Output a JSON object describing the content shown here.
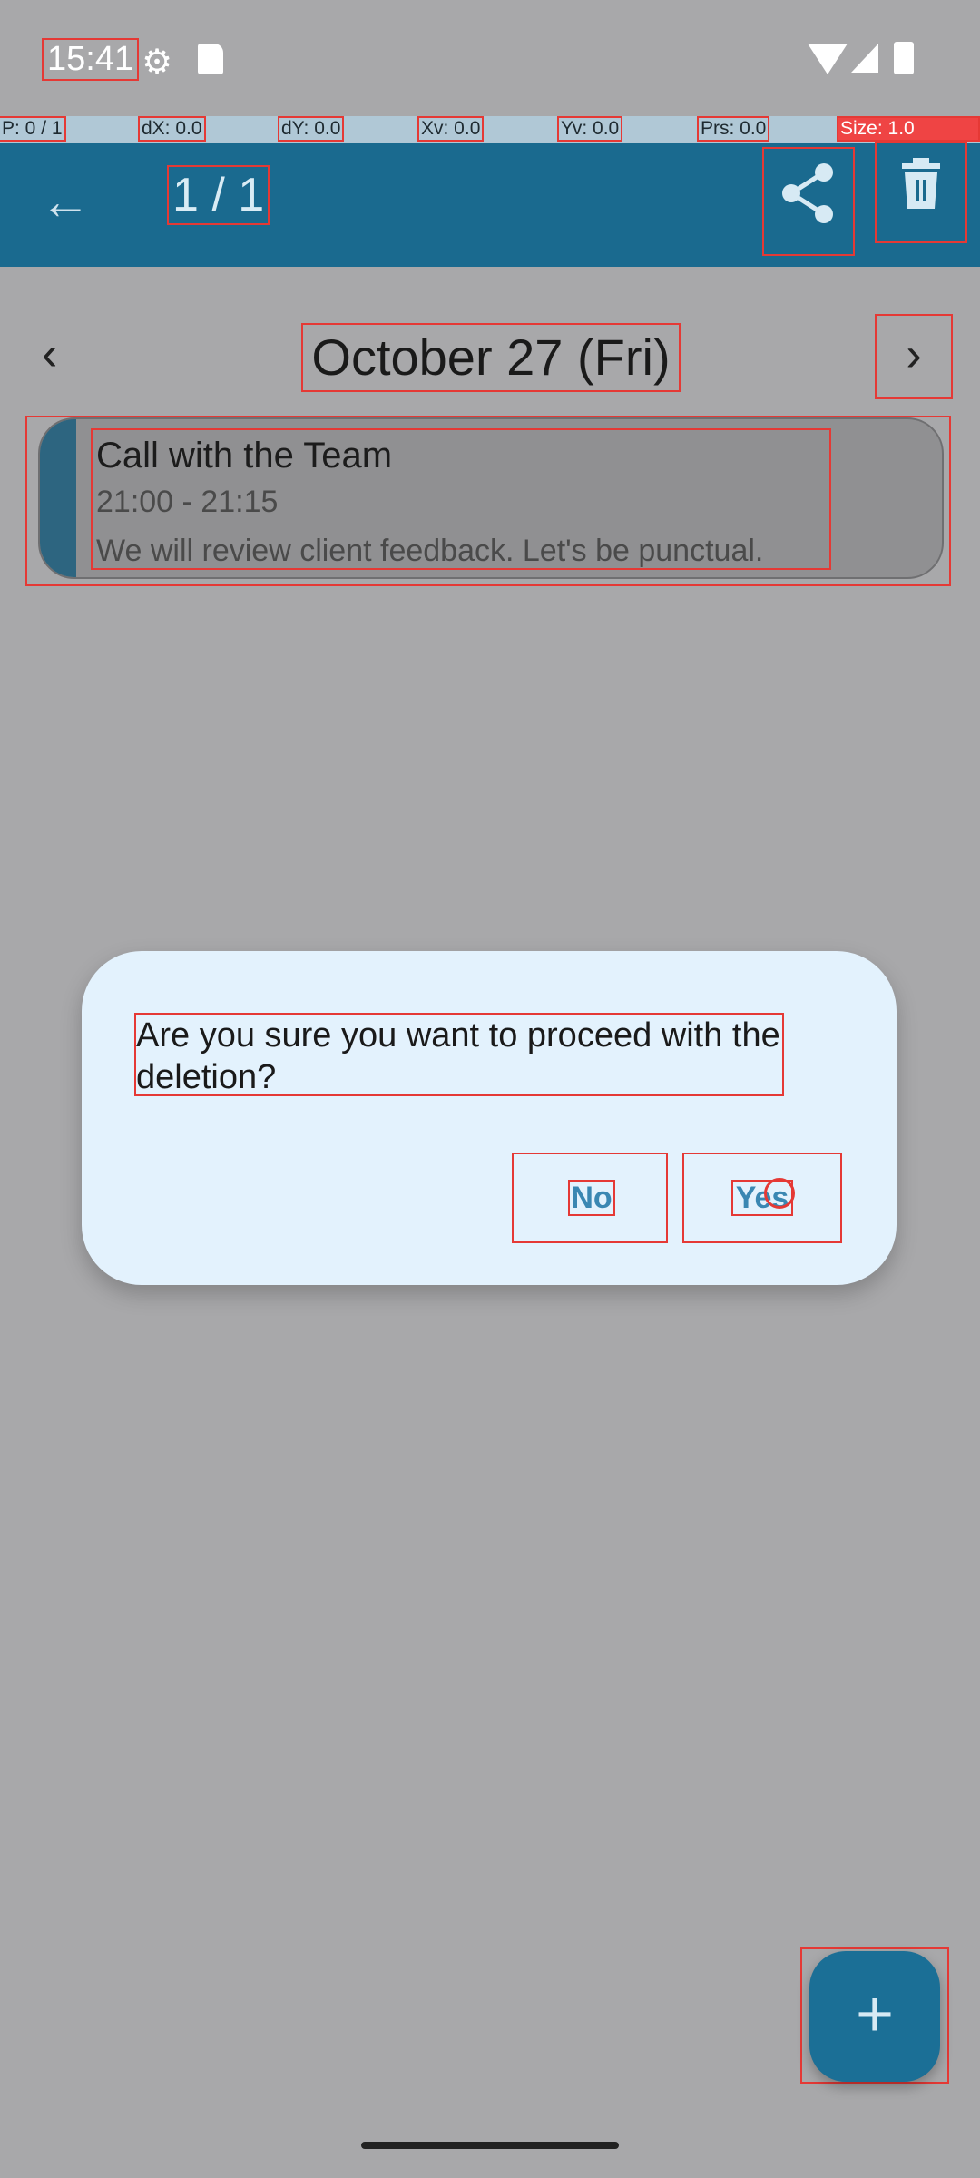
{
  "status_bar": {
    "time": "15:41",
    "icons": [
      "gear-icon",
      "sd-card-icon",
      "wifi-icon",
      "signal-icon",
      "battery-icon"
    ]
  },
  "debug_overlay": {
    "pointer": "P: 0 / 1",
    "dx": "dX: 0.0",
    "dy": "dY: 0.0",
    "xv": "Xv: 0.0",
    "yv": "Yv: 0.0",
    "prs": "Prs: 0.0",
    "size": "Size: 1.0"
  },
  "app_bar": {
    "back_icon": "arrow-back-icon",
    "page_counter": "1 / 1",
    "share_icon": "share-icon",
    "delete_icon": "delete-icon",
    "color": "#1a6a8f"
  },
  "date_header": {
    "title": "October 27 (Fri)",
    "prev_icon": "chevron-left-icon",
    "next_icon": "chevron-right-icon"
  },
  "event": {
    "title": "Call with the Team",
    "time": "21:00 - 21:15",
    "description": "We will review client feedback. Let's be punctual."
  },
  "dialog": {
    "message": "Are you sure you want to proceed with the deletion?",
    "no_label": "No",
    "yes_label": "Yes",
    "button_color": "#3a87b2"
  },
  "fab": {
    "icon": "plus-icon",
    "label": "+"
  }
}
